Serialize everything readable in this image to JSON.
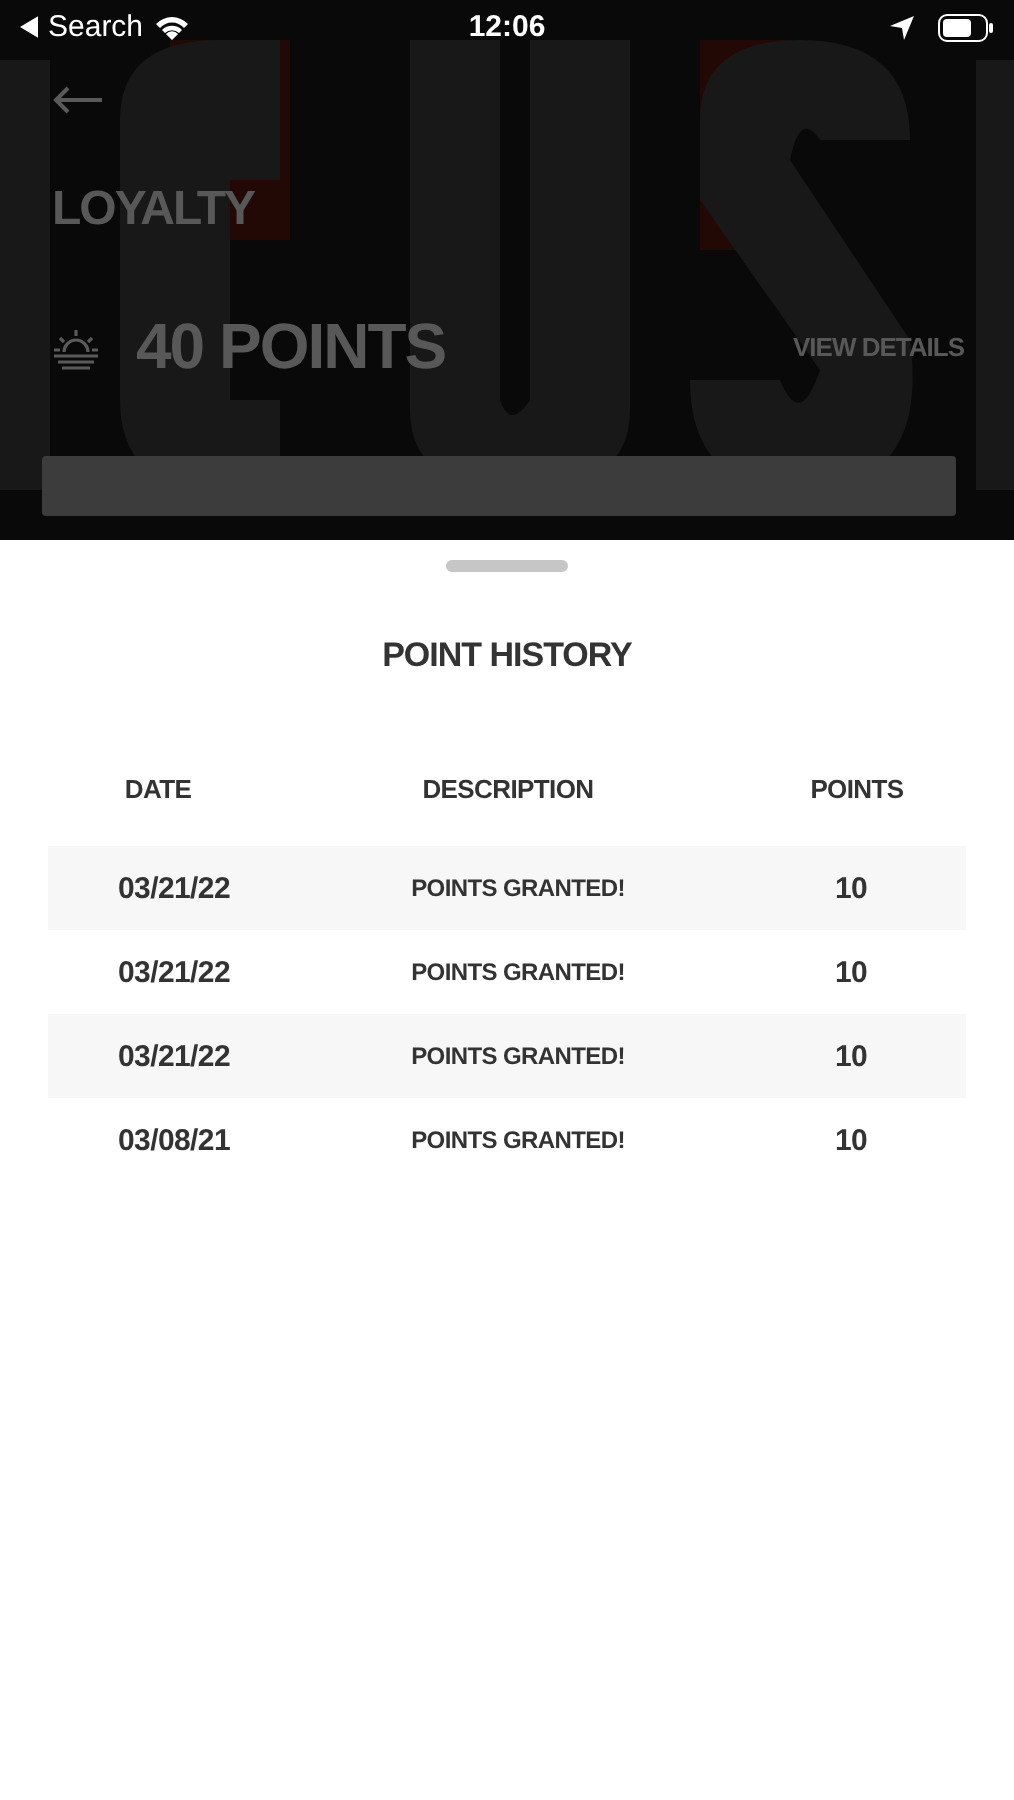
{
  "status_bar": {
    "back_label": "Search",
    "time": "12:06"
  },
  "header": {
    "title": "LOYALTY",
    "points": "40 POINTS",
    "details_link": "VIEW DETAILS"
  },
  "sheet": {
    "title": "POINT HISTORY",
    "table": {
      "columns": [
        "DATE",
        "DESCRIPTION",
        "POINTS"
      ],
      "rows": [
        {
          "date": "03/21/22",
          "description": "POINTS GRANTED!",
          "points": "10"
        },
        {
          "date": "03/21/22",
          "description": "POINTS GRANTED!",
          "points": "10"
        },
        {
          "date": "03/21/22",
          "description": "POINTS GRANTED!",
          "points": "10"
        },
        {
          "date": "03/08/21",
          "description": "POINTS GRANTED!",
          "points": "10"
        }
      ]
    }
  }
}
